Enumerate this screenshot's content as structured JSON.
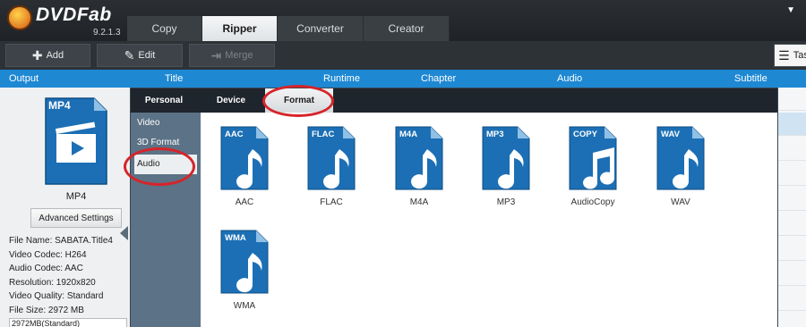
{
  "app": {
    "name": "DVDFab",
    "version": "9.2.1.3"
  },
  "top_tabs": [
    {
      "label": "Copy",
      "active": false
    },
    {
      "label": "Ripper",
      "active": true
    },
    {
      "label": "Converter",
      "active": false
    },
    {
      "label": "Creator",
      "active": false
    }
  ],
  "toolbar": {
    "add_label": "Add",
    "edit_label": "Edit",
    "merge_label": "Merge",
    "task_label": "Tas"
  },
  "columns": {
    "output": "Output",
    "title": "Title",
    "runtime": "Runtime",
    "chapter": "Chapter",
    "audio": "Audio",
    "subtitle": "Subtitle"
  },
  "left_panel": {
    "icon_tag": "MP4",
    "profile_name": "MP4",
    "advanced_button": "Advanced Settings",
    "info": [
      "File Name: SABATA.Title4",
      "Video Codec: H264",
      "Audio Codec: AAC",
      "Resolution: 1920x820",
      "Video Quality: Standard",
      "File Size: 2972 MB"
    ],
    "size_select_value": "2972MB(Standard)"
  },
  "popup": {
    "tabs": [
      {
        "label": "Personal",
        "active": false
      },
      {
        "label": "Device",
        "active": false
      },
      {
        "label": "Format",
        "active": true
      }
    ],
    "categories": [
      {
        "label": "Video",
        "active": false
      },
      {
        "label": "3D Format",
        "active": false
      },
      {
        "label": "Audio",
        "active": true
      }
    ],
    "formats": [
      {
        "tag": "AAC",
        "label": "AAC",
        "glyph": "single-note"
      },
      {
        "tag": "FLAC",
        "label": "FLAC",
        "glyph": "single-note"
      },
      {
        "tag": "M4A",
        "label": "M4A",
        "glyph": "single-note"
      },
      {
        "tag": "MP3",
        "label": "MP3",
        "glyph": "single-note"
      },
      {
        "tag": "COPY",
        "label": "AudioCopy",
        "glyph": "double-note"
      },
      {
        "tag": "WAV",
        "label": "WAV",
        "glyph": "single-note"
      },
      {
        "tag": "WMA",
        "label": "WMA",
        "glyph": "single-note"
      }
    ]
  },
  "colors": {
    "accent_blue": "#1e88d3",
    "icon_blue": "#1c6fb4",
    "annotation_red": "#d6242a",
    "sidebar_slate": "#5c7286"
  }
}
